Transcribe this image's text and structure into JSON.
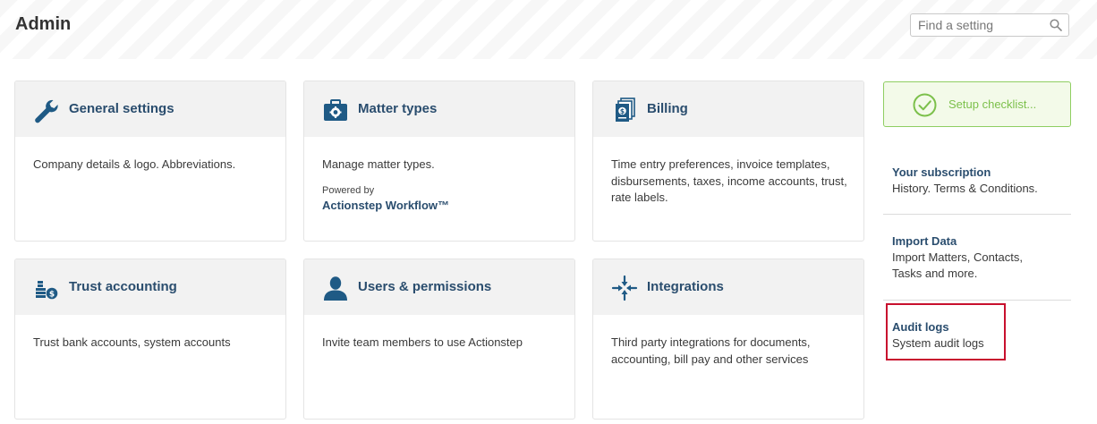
{
  "header": {
    "title": "Admin",
    "search_placeholder": "Find a setting"
  },
  "cards": [
    {
      "title": "General settings",
      "description": "Company details & logo. Abbreviations.",
      "icon": "wrench-icon"
    },
    {
      "title": "Matter types",
      "description": "Manage matter types.",
      "powered_by_label": "Powered by",
      "powered_by_link": "Actionstep Workflow™",
      "icon": "toolbox-icon"
    },
    {
      "title": "Billing",
      "description": "Time entry preferences, invoice templates, disbursements, taxes, income accounts, trust, rate labels.",
      "icon": "invoice-icon"
    },
    {
      "title": "Trust accounting",
      "description": "Trust bank accounts, system accounts",
      "icon": "coins-icon"
    },
    {
      "title": "Users & permissions",
      "description": "Invite team members to use Actionstep",
      "icon": "user-icon"
    },
    {
      "title": "Integrations",
      "description": "Third party integrations for documents, accounting, bill pay and other services",
      "icon": "arrows-in-icon"
    }
  ],
  "sidebar": {
    "checklist_label": "Setup checklist...",
    "items": [
      {
        "title": "Your subscription",
        "description": "History. Terms & Conditions."
      },
      {
        "title": "Import Data",
        "description": "Import Matters, Contacts, Tasks and more."
      },
      {
        "title": "Audit logs",
        "description": "System audit logs"
      }
    ]
  },
  "colors": {
    "link": "#2a4d6e",
    "icon": "#1f5a85",
    "checklist_green": "#7cc04b",
    "highlight_red": "#c8102e"
  }
}
